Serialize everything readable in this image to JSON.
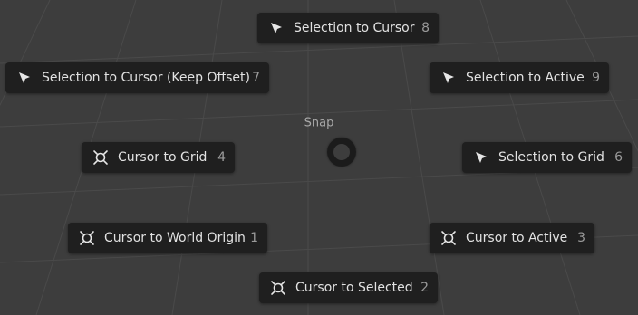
{
  "pie_menu": {
    "title": "Snap",
    "items": [
      {
        "label": "Selection to Cursor",
        "hotkey": "8",
        "icon": "cursor-arrow-icon"
      },
      {
        "label": "Selection to Cursor (Keep Offset)",
        "hotkey": "7",
        "icon": "cursor-arrow-icon"
      },
      {
        "label": "Selection to Active",
        "hotkey": "9",
        "icon": "cursor-arrow-icon"
      },
      {
        "label": "Cursor to Grid",
        "hotkey": "4",
        "icon": "3d-cursor-icon"
      },
      {
        "label": "Selection to Grid",
        "hotkey": "6",
        "icon": "cursor-arrow-icon"
      },
      {
        "label": "Cursor to World Origin",
        "hotkey": "1",
        "icon": "3d-cursor-icon"
      },
      {
        "label": "Cursor to Active",
        "hotkey": "3",
        "icon": "3d-cursor-icon"
      },
      {
        "label": "Cursor to Selected",
        "hotkey": "2",
        "icon": "3d-cursor-icon"
      }
    ]
  }
}
